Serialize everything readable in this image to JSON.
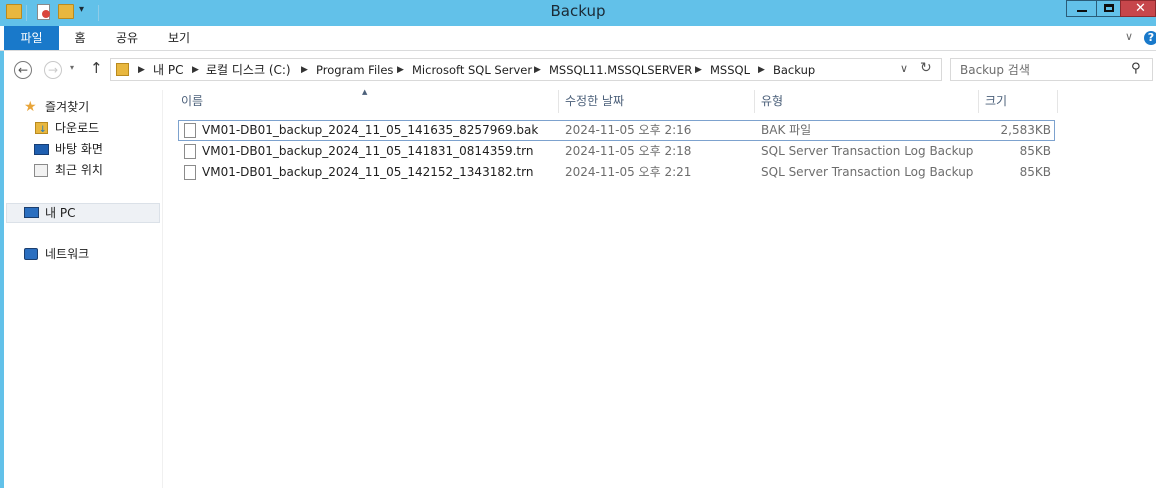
{
  "window": {
    "title": "Backup"
  },
  "ribbon": {
    "tabs": [
      {
        "label": "파일",
        "active": true
      },
      {
        "label": "홈"
      },
      {
        "label": "공유"
      },
      {
        "label": "보기"
      }
    ]
  },
  "address": {
    "crumbs": [
      "내 PC",
      "로컬 디스크 (C:)",
      "Program Files",
      "Microsoft SQL Server",
      "MSSQL11.MSSQLSERVER",
      "MSSQL",
      "Backup"
    ]
  },
  "search": {
    "placeholder": "Backup 검색"
  },
  "nav": {
    "favorites": "즐겨찾기",
    "downloads": "다운로드",
    "desktop": "바탕 화면",
    "recent": "최근 위치",
    "pc": "내 PC",
    "network": "네트워크"
  },
  "columns": {
    "name": "이름",
    "date": "수정한 날짜",
    "type": "유형",
    "size": "크기"
  },
  "files": [
    {
      "name": "VM01-DB01_backup_2024_11_05_141635_8257969.bak",
      "date": "2024-11-05 오후 2:16",
      "type": "BAK 파일",
      "size": "2,583KB"
    },
    {
      "name": "VM01-DB01_backup_2024_11_05_141831_0814359.trn",
      "date": "2024-11-05 오후 2:18",
      "type": "SQL Server Transaction Log Backup",
      "size": "85KB"
    },
    {
      "name": "VM01-DB01_backup_2024_11_05_142152_1343182.trn",
      "date": "2024-11-05 오후 2:21",
      "type": "SQL Server Transaction Log Backup",
      "size": "85KB"
    }
  ],
  "colors": {
    "titlebar": "#62c1e9",
    "file_tab": "#1979ca",
    "selection": "#7da2ce"
  }
}
